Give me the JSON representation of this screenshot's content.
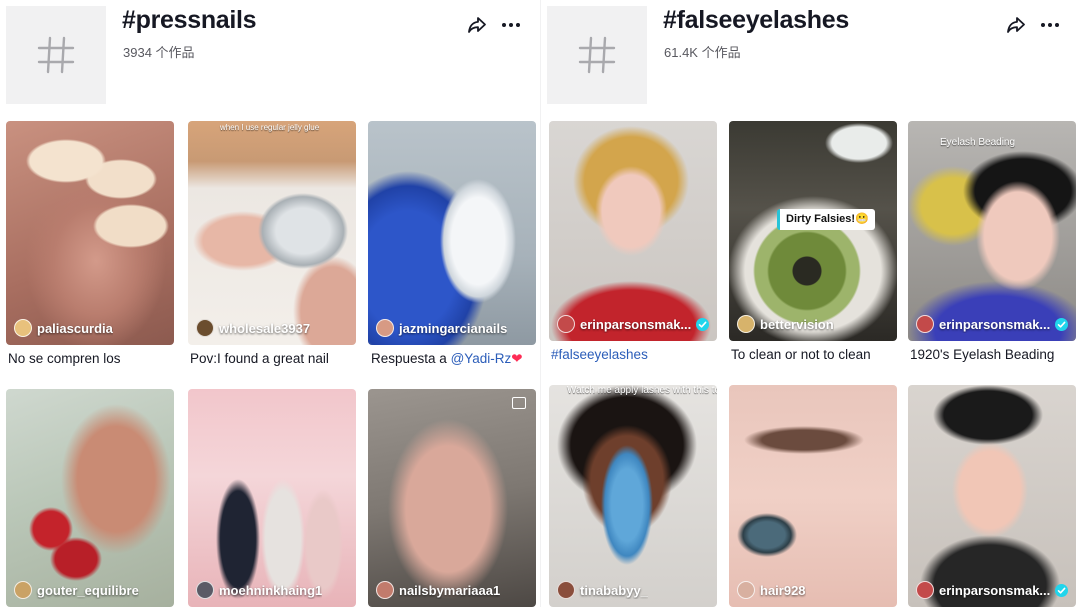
{
  "left": {
    "tag": "#pressnails",
    "count": "3934 个作品",
    "videos": [
      {
        "author": "paliascurdia",
        "caption": "No se compren los"
      },
      {
        "author": "wholesale3937",
        "caption": "Pov:I found a great nail",
        "overlay": "when I use regular jelly glue"
      },
      {
        "author": "jazmingarcianails",
        "caption_prefix": "Respuesta a ",
        "mention": "@Yadi-Rz",
        "heart": "❤"
      },
      {
        "author": "gouter_equilibre"
      },
      {
        "author": "moehninkhaing1"
      },
      {
        "author": "nailsbymariaaa1"
      }
    ]
  },
  "right": {
    "tag": "#falseeyelashes",
    "count": "61.4K 个作品",
    "videos": [
      {
        "author": "erinparsonsmak...",
        "caption": "#falseeyelashes",
        "verified": true
      },
      {
        "author": "bettervision",
        "caption": "To clean or not to clean",
        "sticker": "Dirty Falsies!😬"
      },
      {
        "author": "erinparsonsmak...",
        "caption": "1920's Eyelash Beading",
        "verified": true,
        "overlay": "Eyelash Beading"
      },
      {
        "author": "tinababyy_",
        "overlay": "Watch me apply lashes with this tool"
      },
      {
        "author": "hair928"
      },
      {
        "author": "erinparsonsmak...",
        "verified": true
      }
    ]
  },
  "icons": {
    "hashtag": "hashtag-icon",
    "share": "share-icon",
    "more": "more-icon",
    "photo": "photo-icon"
  },
  "colors": {
    "link": "#2b5db9",
    "verified": "#20d5ec",
    "heart": "#fe2c55",
    "placeholder": "#f1f1f2"
  }
}
